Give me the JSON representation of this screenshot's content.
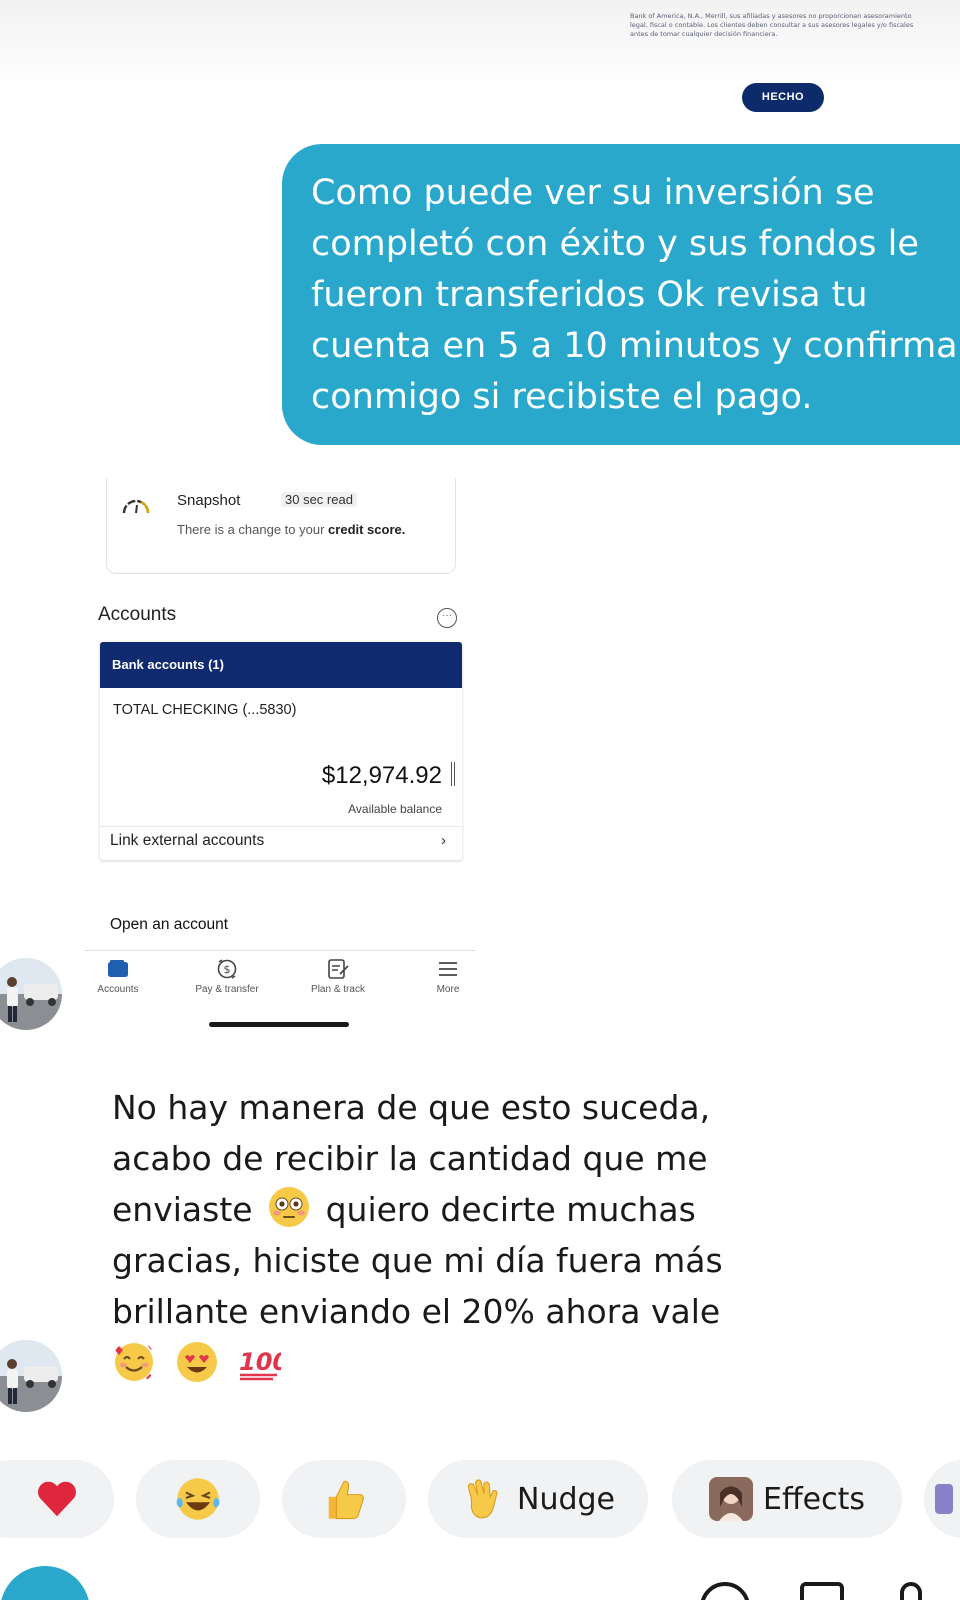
{
  "shared_image": {
    "disclaimer_text": "Bank of America, N.A., Merrill, sus afiliadas y asesores no proporcionan asesoramiento legal, fiscal o contable. Los clientes deben consultar a sus asesores legales y/o fiscales antes de tomar cualquier decisión financiera.",
    "done_button": "HECHO"
  },
  "outgoing_message": {
    "text": "Como puede ver su inversión se\ncompletó con éxito y sus fondos le\nfueron transferidos Ok revisa tu\ncuenta en 5 a 10 minutos y confirma\nconmigo si recibiste el pago."
  },
  "bank_screenshot": {
    "snapshot": {
      "title": "Snapshot",
      "badge": "30 sec read",
      "text_prefix": "There is a change to your",
      "text_bold": "credit score."
    },
    "accounts_heading": "Accounts",
    "bank_accounts_header": "Bank accounts (1)",
    "account_name": "TOTAL CHECKING (...5830)",
    "balance": "$12,974.92",
    "balance_label": "Available balance",
    "link_external": "Link external accounts",
    "link_chevron": "›",
    "open_account": "Open an account",
    "tabs": [
      {
        "label": "Accounts",
        "icon": "wallet-icon"
      },
      {
        "label": "Pay & transfer",
        "icon": "dollar-transfer-icon"
      },
      {
        "label": "Plan & track",
        "icon": "checklist-icon"
      },
      {
        "label": "More",
        "icon": "menu-icon"
      }
    ],
    "more_icon_glyph": "···"
  },
  "incoming_message": {
    "text_lines": [
      "No hay manera de que esto suceda,",
      "acabo de recibir la cantidad que me",
      "enviaste",
      "quiero decirte muchas",
      "gracias, hiciste que mi día fuera más",
      "brillante enviando el 20% ahora vale"
    ],
    "emojis": [
      "flushed-face-emoji",
      "smiling-face-with-hearts-emoji",
      "heart-eyes-emoji",
      "hundred-points-emoji"
    ]
  },
  "reactions": {
    "items": [
      {
        "icon": "heart-icon",
        "label": ""
      },
      {
        "icon": "laughing-tears-icon",
        "label": ""
      },
      {
        "icon": "thumbs-up-icon",
        "label": ""
      },
      {
        "icon": "waving-hand-icon",
        "label": "Nudge"
      },
      {
        "icon": "effects-photo-icon",
        "label": "Effects"
      }
    ]
  },
  "colors": {
    "bubble_blue": "#29a8cc",
    "bank_navy": "#0f2a6e",
    "chip_bg": "#f1f2f4"
  }
}
